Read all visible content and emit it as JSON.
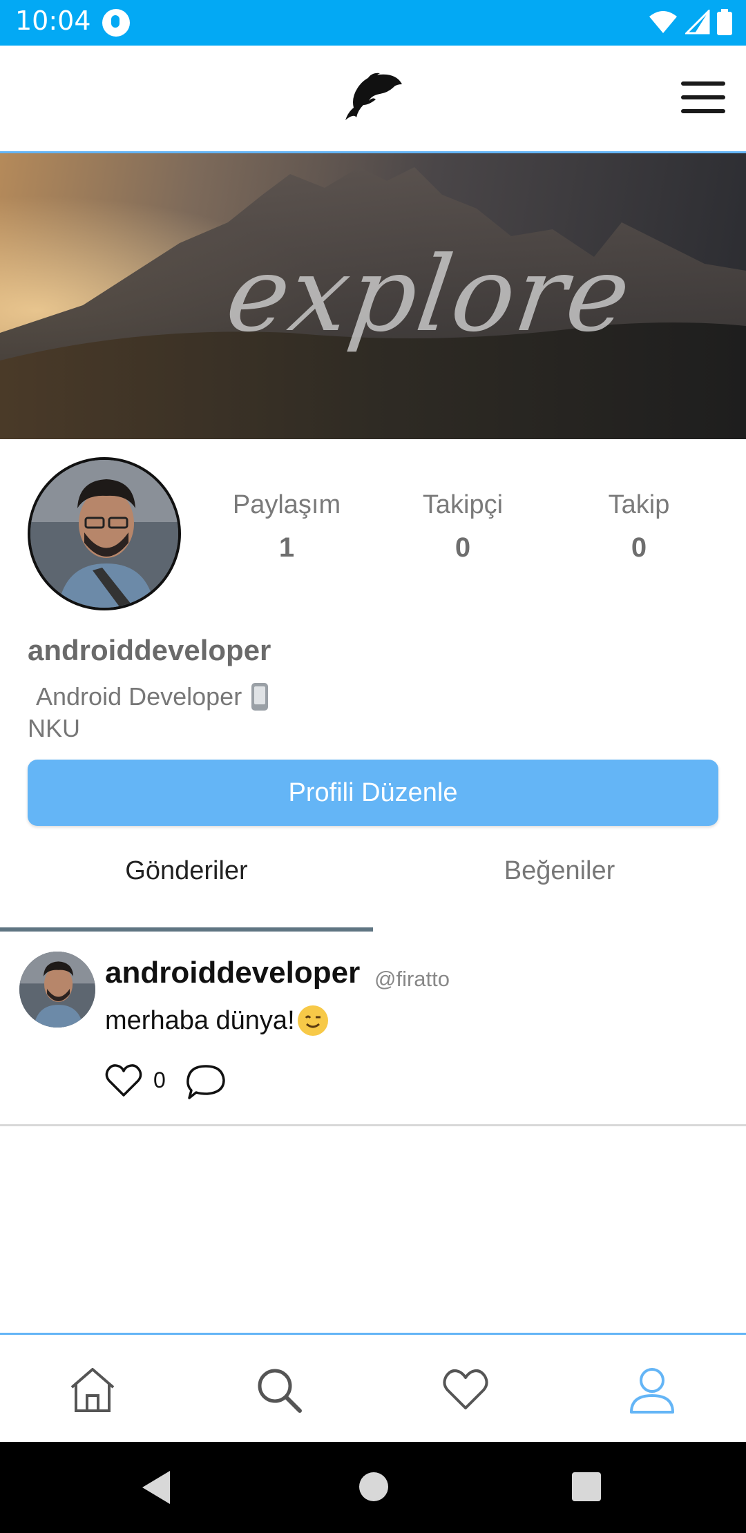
{
  "status_bar": {
    "time": "10:04"
  },
  "app_bar": {
    "logo": "dolphin-logo",
    "menu_icon": "hamburger-menu-icon"
  },
  "cover": {
    "text": "explore"
  },
  "profile": {
    "stats": [
      {
        "label": "Paylaşım",
        "value": "1"
      },
      {
        "label": "Takipçi",
        "value": "0"
      },
      {
        "label": "Takip",
        "value": "0"
      }
    ],
    "username": "androiddeveloper",
    "bio_line1": "Android Developer",
    "bio_line2": "NKU",
    "edit_button": "Profili Düzenle"
  },
  "tabs": [
    {
      "label": "Gönderiler",
      "active": true
    },
    {
      "label": "Beğeniler",
      "active": false
    }
  ],
  "posts": [
    {
      "author": "androiddeveloper",
      "handle": "@firatto",
      "text": "merhaba dünya!",
      "likes": "0"
    }
  ],
  "bottom_nav": [
    "home-icon",
    "search-icon",
    "heart-icon",
    "profile-icon"
  ],
  "colors": {
    "status_bar": "#03A9F4",
    "accent": "#64B5F6",
    "tab_indicator": "#5f7582"
  }
}
